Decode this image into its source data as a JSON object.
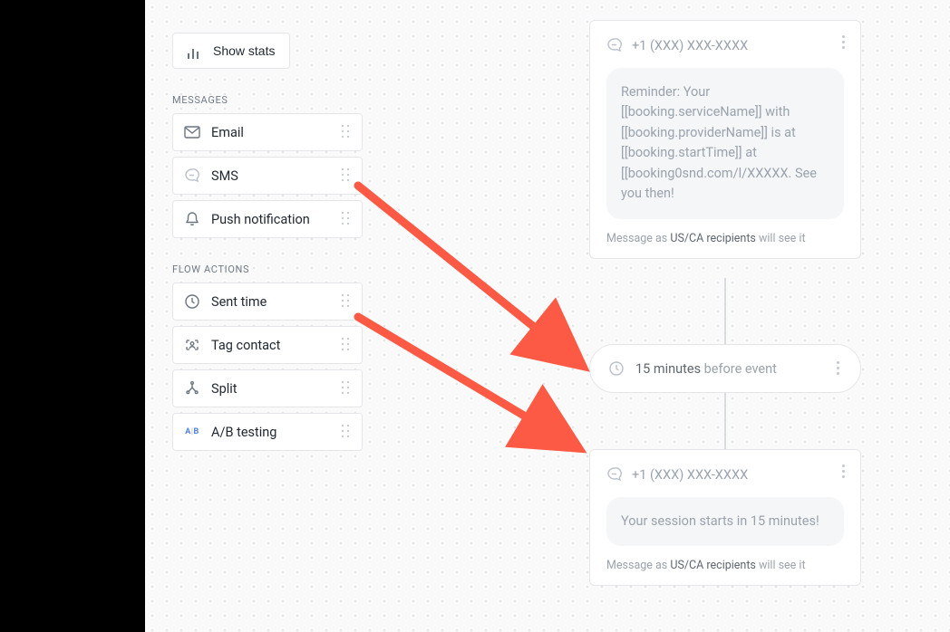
{
  "toolbar": {
    "show_stats": "Show stats"
  },
  "sections": {
    "messages_title": "MESSAGES",
    "flow_actions_title": "FLOW ACTIONS"
  },
  "messages": {
    "email": "Email",
    "sms": "SMS",
    "push": "Push notification"
  },
  "flow_actions": {
    "sent_time": "Sent time",
    "tag_contact": "Tag contact",
    "split": "Split",
    "ab_testing": "A/B testing"
  },
  "node1": {
    "phone": "+1 (XXX) XXX-XXXX",
    "body": "Reminder: Your [[booking.serviceName]] with [[booking.providerName]] is at [[booking.startTime]] at [[booking0snd.com/l/XXXXX. See you then!",
    "foot_pre": "Message as ",
    "foot_rec": "US/CA recipients",
    "foot_post": " will see it"
  },
  "pill": {
    "minutes": "15 minutes",
    "rest": " before event"
  },
  "node2": {
    "phone": "+1 (XXX) XXX-XXXX",
    "body": "Your session starts in 15 minutes!",
    "foot_pre": "Message as ",
    "foot_rec": "US/CA recipients",
    "foot_post": " will see it"
  }
}
